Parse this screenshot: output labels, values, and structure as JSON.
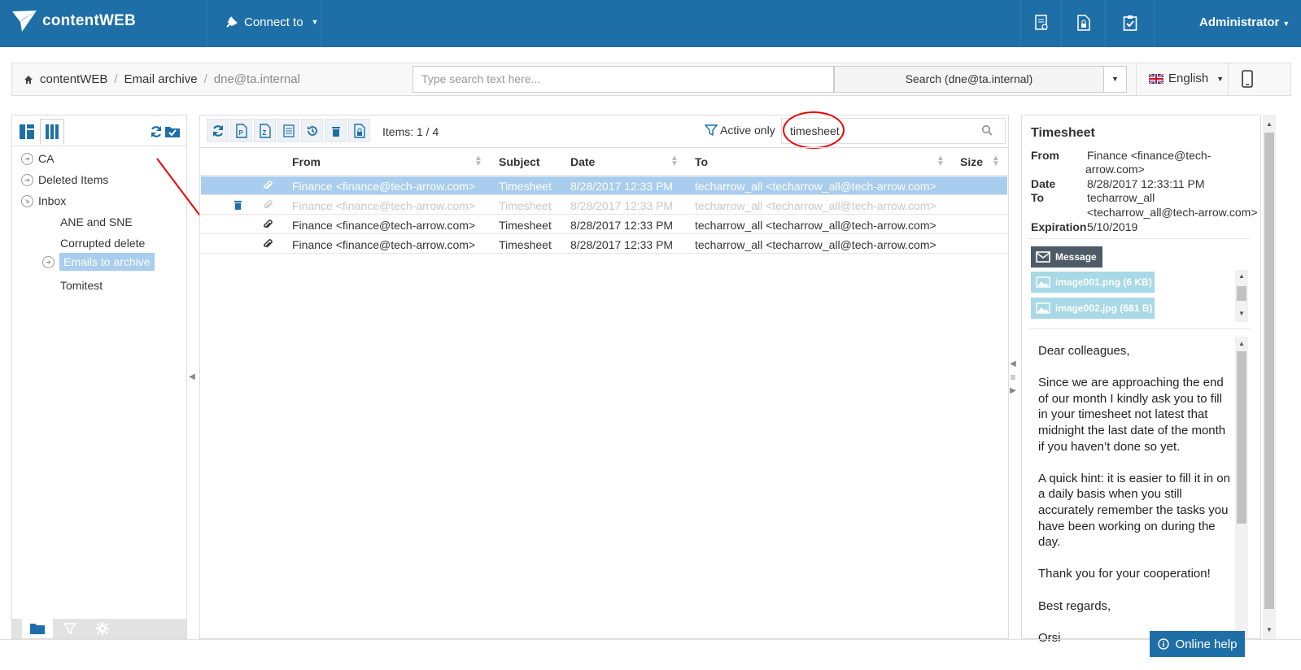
{
  "topbar": {
    "brand": "contentWEB",
    "connect_label": "Connect to",
    "user": "Administrator",
    "icons": [
      "report-icon",
      "lock-document-icon",
      "clipboard-check-icon"
    ]
  },
  "breadcrumb": {
    "home": "contentWEB",
    "section": "Email archive",
    "current": "dne@ta.internal"
  },
  "search": {
    "placeholder": "Type search text here...",
    "button": "Search (dne@ta.internal)"
  },
  "language": "English",
  "tree": {
    "items": [
      {
        "label": "CA"
      },
      {
        "label": "Deleted Items"
      },
      {
        "label": "Inbox"
      },
      {
        "label": "ANE and SNE"
      },
      {
        "label": "Corrupted delete"
      },
      {
        "label": "Emails to archive"
      },
      {
        "label": "Tomitest"
      }
    ]
  },
  "grid": {
    "items_count": "Items: 1 / 4",
    "active_only": "Active only",
    "filter_value": "timesheet",
    "columns": [
      "From",
      "Subject",
      "Date",
      "To",
      "Size"
    ],
    "rows": [
      {
        "from": "Finance <finance@tech-arrow.com>",
        "subject": "Timesheet",
        "date": "8/28/2017 12:33 PM",
        "to": "techarrow_all <techarrow_all@tech-arrow.com>",
        "state": "selected"
      },
      {
        "from": "Finance <finance@tech-arrow.com>",
        "subject": "Timesheet",
        "date": "8/28/2017 12:33 PM",
        "to": "techarrow_all <techarrow_all@tech-arrow.com>",
        "state": "deleted"
      },
      {
        "from": "Finance <finance@tech-arrow.com>",
        "subject": "Timesheet",
        "date": "8/28/2017 12:33 PM",
        "to": "techarrow_all <techarrow_all@tech-arrow.com>",
        "state": "normal"
      },
      {
        "from": "Finance <finance@tech-arrow.com>",
        "subject": "Timesheet",
        "date": "8/28/2017 12:33 PM",
        "to": "techarrow_all <techarrow_all@tech-arrow.com>",
        "state": "normal"
      }
    ]
  },
  "preview": {
    "title": "Timesheet",
    "labels": {
      "from": "From",
      "date": "Date",
      "to": "To",
      "expiration": "Expiration"
    },
    "from_line1": "Finance <finance@tech-",
    "from_line2": "arrow.com>",
    "date": "8/28/2017 12:33:11 PM",
    "to_line1": "techarrow_all",
    "to_line2": "<techarrow_all@tech-arrow.com>",
    "expiration": "5/10/2019",
    "message_btn": "Message",
    "attachments": [
      "image001.png (6 KB)",
      "image002.jpg (681 B)"
    ],
    "body": [
      "Dear colleagues,",
      "Since we are approaching the end of our month I kindly ask you to fill in your timesheet not latest that midnight the last date of the month if you haven’t done so yet.",
      "A quick hint: it is easier to fill it in on a daily basis when you still accurately remember the tasks you have been working on during the day.",
      "Thank you for your cooperation!",
      "Best regards,",
      "Orsi"
    ]
  },
  "help_label": "Online help",
  "colors": {
    "primary": "#1e6fa8",
    "selection": "#a8cdee",
    "annotation": "#e00000"
  }
}
